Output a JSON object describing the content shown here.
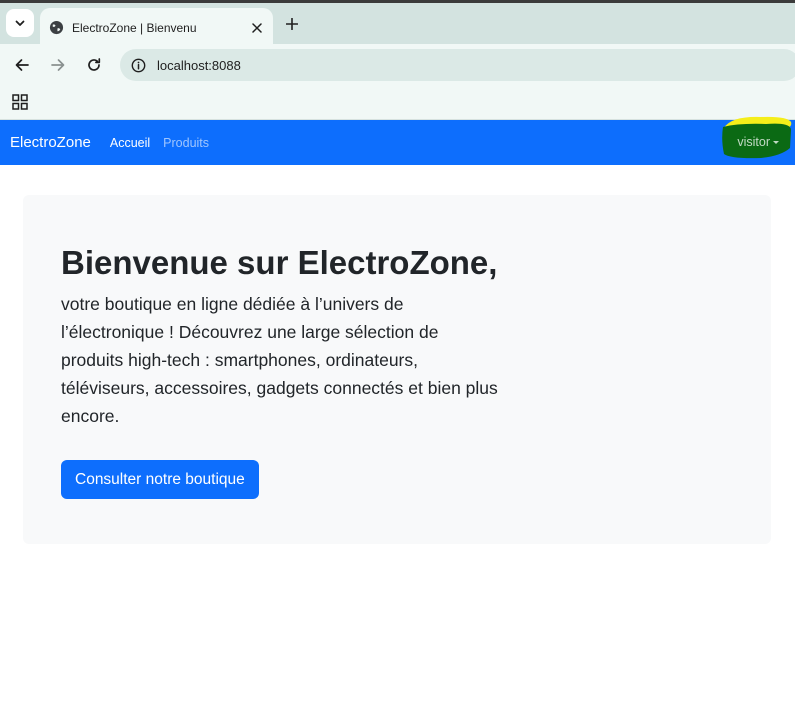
{
  "browser": {
    "tab": {
      "title": "ElectroZone | Bienvenu"
    },
    "address_bar": {
      "url": "localhost:8088"
    }
  },
  "navbar": {
    "brand": "ElectroZone",
    "links": [
      {
        "label": "Accueil",
        "active": true
      },
      {
        "label": "Produits",
        "active": false
      }
    ],
    "user_menu": {
      "label": "visitor"
    }
  },
  "hero": {
    "title": "Bienvenue sur ElectroZone,",
    "description": "votre boutique en ligne dédiée à l’univers de l’électronique ! Découvrez une large sélection de produits high-tech : smartphones, ordinateurs, téléviseurs, accessoires, gadgets connectés et bien plus encore.",
    "cta_label": "Consulter notre boutique"
  },
  "colors": {
    "primary": "#0d6efd",
    "hero_background": "#f8f9fa",
    "annotation_highlight": "#f5ee1a",
    "annotation_mark": "#0b6a14"
  },
  "icons": {
    "tab_search": "chevron-down-icon",
    "favicon": "globe-icon",
    "tab_close": "close-icon",
    "new_tab": "plus-icon",
    "back": "arrow-left-icon",
    "forward": "arrow-right-icon",
    "reload": "reload-icon",
    "site_info": "info-icon",
    "apps": "apps-grid-icon"
  }
}
